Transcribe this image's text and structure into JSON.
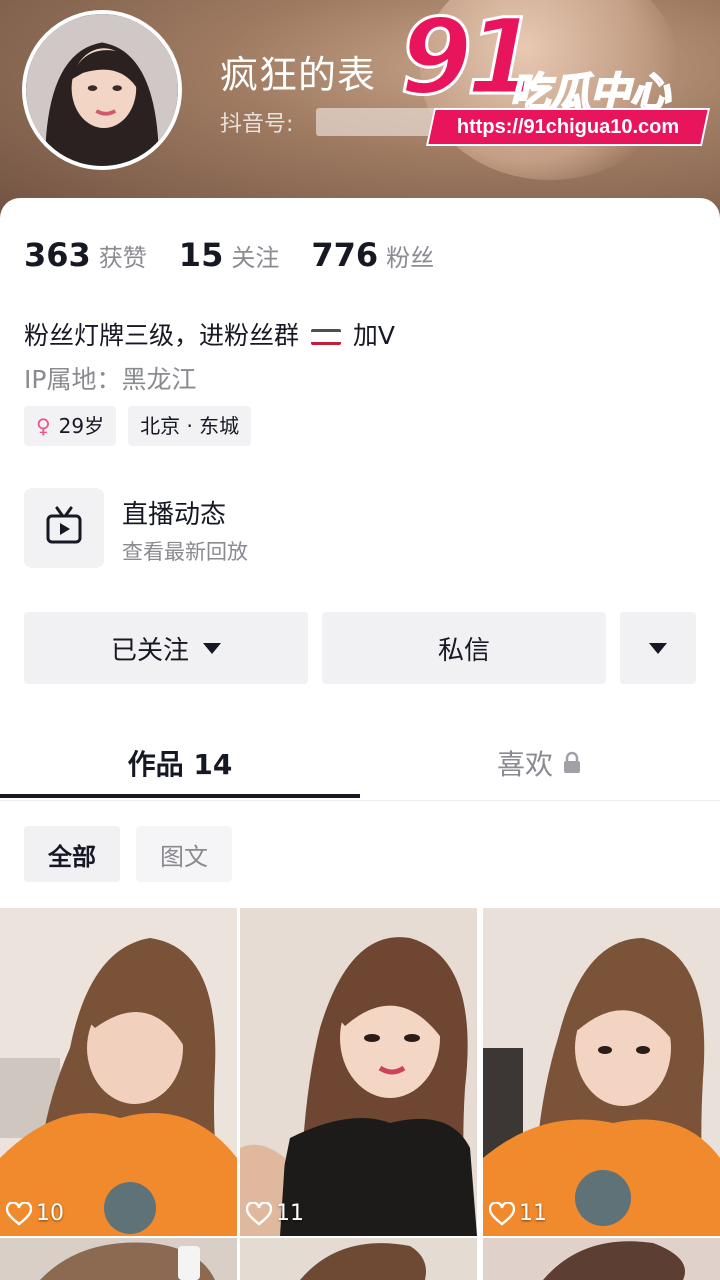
{
  "profile": {
    "nickname": "疯狂的表",
    "douyin_id_label": "抖音号:"
  },
  "watermark": {
    "big": "91",
    "cn": "吃瓜中心",
    "url": "https://91chigua10.com"
  },
  "stats": [
    {
      "num": "363",
      "label": "获赞"
    },
    {
      "num": "15",
      "label": "关注"
    },
    {
      "num": "776",
      "label": "粉丝"
    }
  ],
  "bio": {
    "line1_a": "粉丝灯牌三级，进粉丝群",
    "line1_b": "加V",
    "ip": "IP属地：黑龙江"
  },
  "tags": {
    "female_symbol": "♀",
    "age": "29岁",
    "location": "北京 · 东城"
  },
  "live": {
    "title": "直播动态",
    "subtitle": "查看最新回放",
    "icon": "tv-icon"
  },
  "buttons": {
    "followed": "已关注",
    "message": "私信"
  },
  "tabs": {
    "works": "作品 14",
    "likes": "喜欢"
  },
  "filters": {
    "all": "全部",
    "image_text": "图文"
  },
  "grid": {
    "items": [
      {
        "likes": "10"
      },
      {
        "likes": "11"
      },
      {
        "likes": "11"
      }
    ]
  },
  "colors": {
    "watermark_pink": "#e8155c",
    "text_primary": "#161823",
    "text_secondary": "#8a8b91",
    "female_pink": "#f0508a"
  }
}
